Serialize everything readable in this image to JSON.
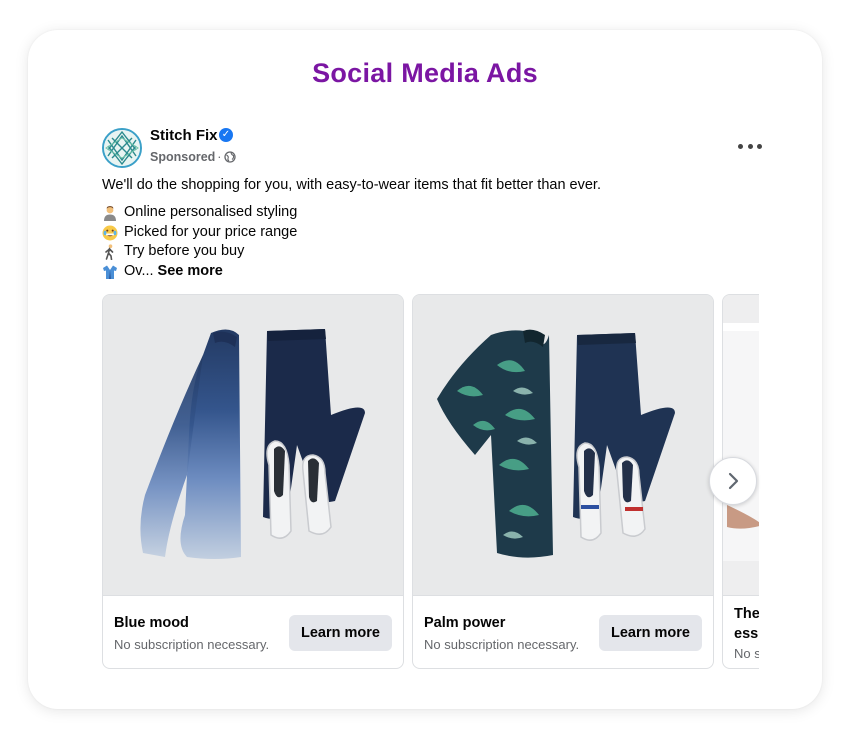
{
  "page": {
    "title": "Social Media Ads"
  },
  "post": {
    "page_name": "Stitch Fix",
    "sponsored_label": "Sponsored",
    "separator": "·",
    "intro_text": "We'll do the shopping for you, with easy-to-wear items that fit better than ever.",
    "bullets": [
      {
        "icon": "person-emoji",
        "text": "Online personalised styling"
      },
      {
        "icon": "grinning-face-emoji",
        "text": "Picked for your price range"
      },
      {
        "icon": "person-walking-emoji",
        "text": "Try before you buy"
      },
      {
        "icon": "shirt-emoji",
        "text": "Ov..."
      }
    ],
    "see_more_label": "See more"
  },
  "carousel": {
    "cards": [
      {
        "headline": "Blue mood",
        "description": "No subscription necessary.",
        "cta_label": "Learn more",
        "image": "striped-sweater-navy-chinos-white-sneakers"
      },
      {
        "headline": "Palm power",
        "description": "No subscription necessary.",
        "cta_label": "Learn more",
        "image": "palm-print-shirt-navy-chinos-sneakers"
      },
      {
        "headline": "The ess...",
        "headline_line1": "The",
        "headline_line2": "ess",
        "description": "No s",
        "image": "partially-visible-product-photo"
      }
    ],
    "next_icon": "chevron-right-icon"
  },
  "colors": {
    "title": "#7b16a3",
    "verified": "#1877f2",
    "cta_bg": "#e4e6eb",
    "secondary_text": "#65676b"
  }
}
